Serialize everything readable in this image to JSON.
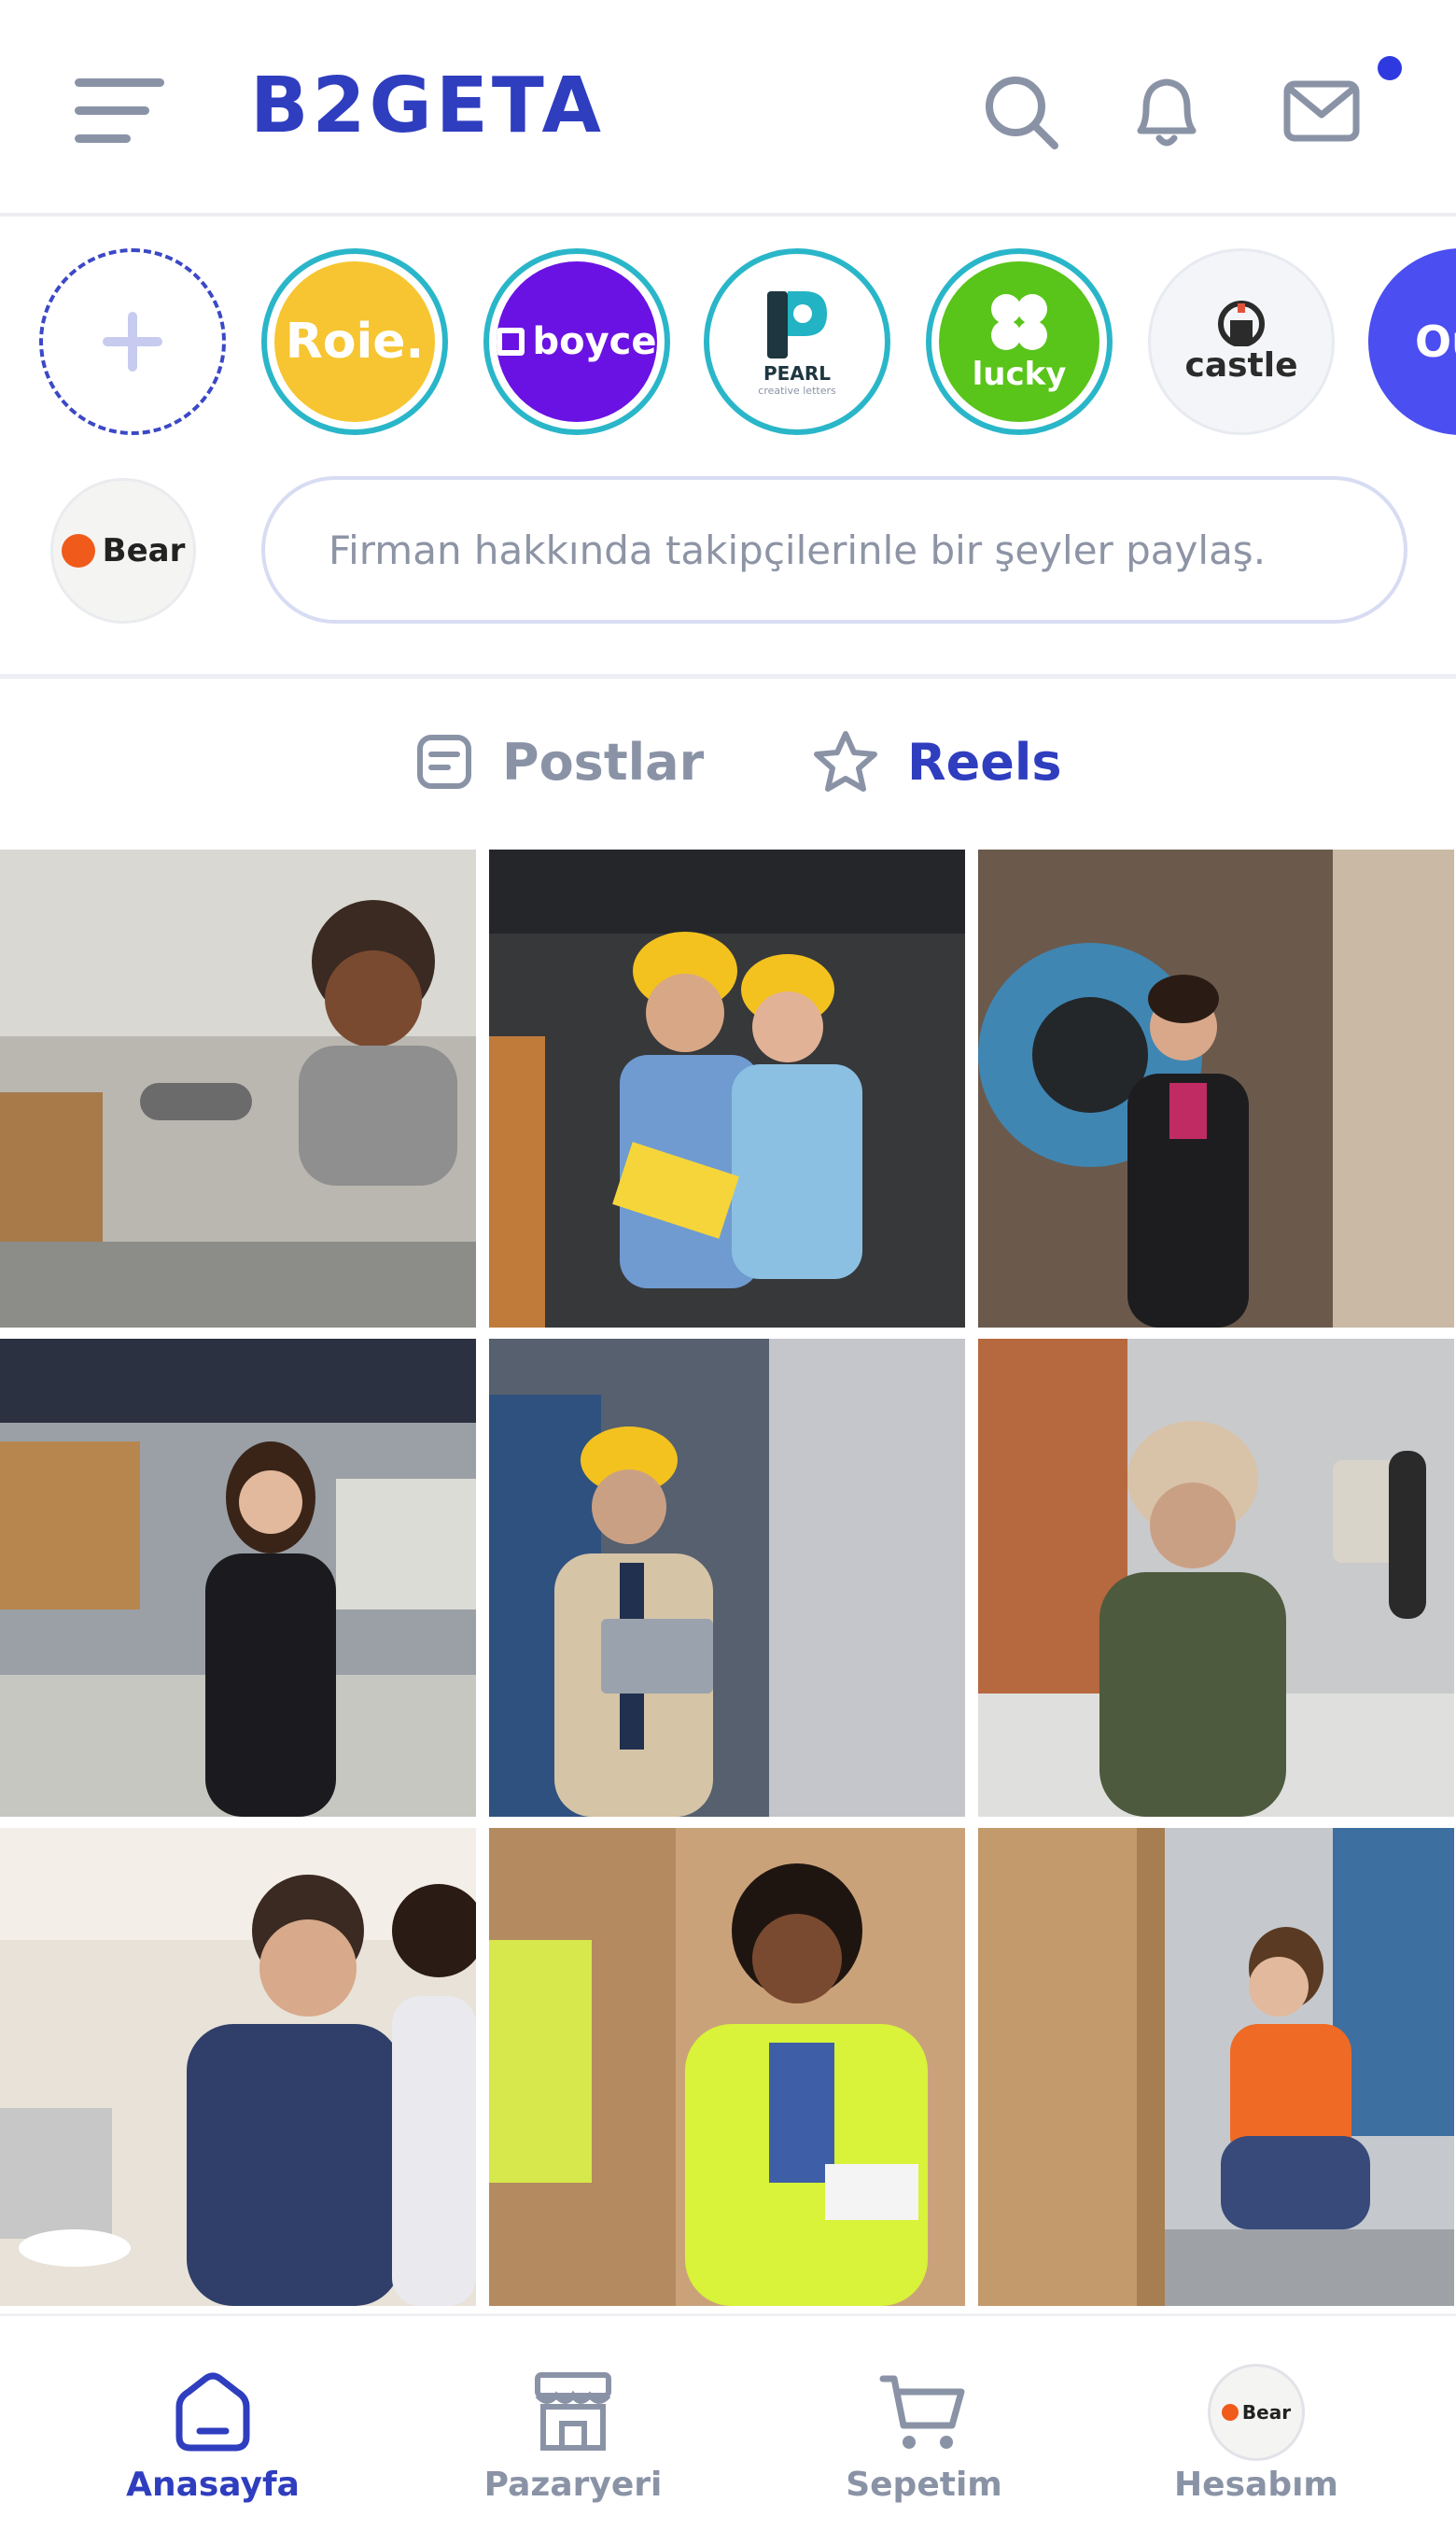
{
  "header": {
    "logo": "B2GETA",
    "menu_icon": "hamburger-icon",
    "search_icon": "search-icon",
    "notifications_icon": "bell-icon",
    "messages_icon": "mail-icon",
    "has_unread": true
  },
  "stories": [
    {
      "type": "add",
      "icon": "plus-icon"
    },
    {
      "type": "brand",
      "label": "Roie.",
      "bg": "#f6c531",
      "fg": "#ffffff"
    },
    {
      "type": "brand",
      "label": "boyce",
      "bg": "#6a12e3",
      "fg": "#ffffff"
    },
    {
      "type": "brand",
      "label": "PEARL",
      "sub": "creative letters",
      "bg": "#ffffff",
      "fg": "#1e3640"
    },
    {
      "type": "brand",
      "label": "lucky",
      "bg": "#59c41a",
      "fg": "#ffffff"
    },
    {
      "type": "brand",
      "label": "castle",
      "bg": "#f4f5f8",
      "fg": "#2b2b2b"
    },
    {
      "type": "brand",
      "label": "Ou",
      "bg": "#4b4ef0",
      "fg": "#ffffff"
    }
  ],
  "composer": {
    "avatar_label": "Bear",
    "placeholder": "Firman hakkında takipçilerinle bir şeyler paylaş."
  },
  "tabs": {
    "posts": "Postlar",
    "reels": "Reels",
    "active": "reels"
  },
  "reels": [
    {
      "subject": "smiling worker holding metal part in factory"
    },
    {
      "subject": "two engineers with hard hats in warehouse"
    },
    {
      "subject": "woman standing by industrial machine"
    },
    {
      "subject": "businesswoman with arms crossed in warehouse"
    },
    {
      "subject": "engineer with tablet and hard hat"
    },
    {
      "subject": "worker in beanie holding tablet and scanner"
    },
    {
      "subject": "business meeting in cafe"
    },
    {
      "subject": "worker in safety vest using tablet"
    },
    {
      "subject": "woman scanning boxes in warehouse"
    }
  ],
  "bottom_nav": [
    {
      "label": "Anasayfa",
      "icon": "home-icon",
      "active": true
    },
    {
      "label": "Pazaryeri",
      "icon": "store-icon",
      "active": false
    },
    {
      "label": "Sepetim",
      "icon": "cart-icon",
      "active": false
    },
    {
      "label": "Hesabım",
      "icon": "profile-avatar",
      "avatar_label": "Bear",
      "active": false
    }
  ],
  "colors": {
    "brand": "#2f3dbf",
    "muted": "#8a93a6",
    "story_ring": "#2ab6c9",
    "dot": "#2e3ae0"
  }
}
